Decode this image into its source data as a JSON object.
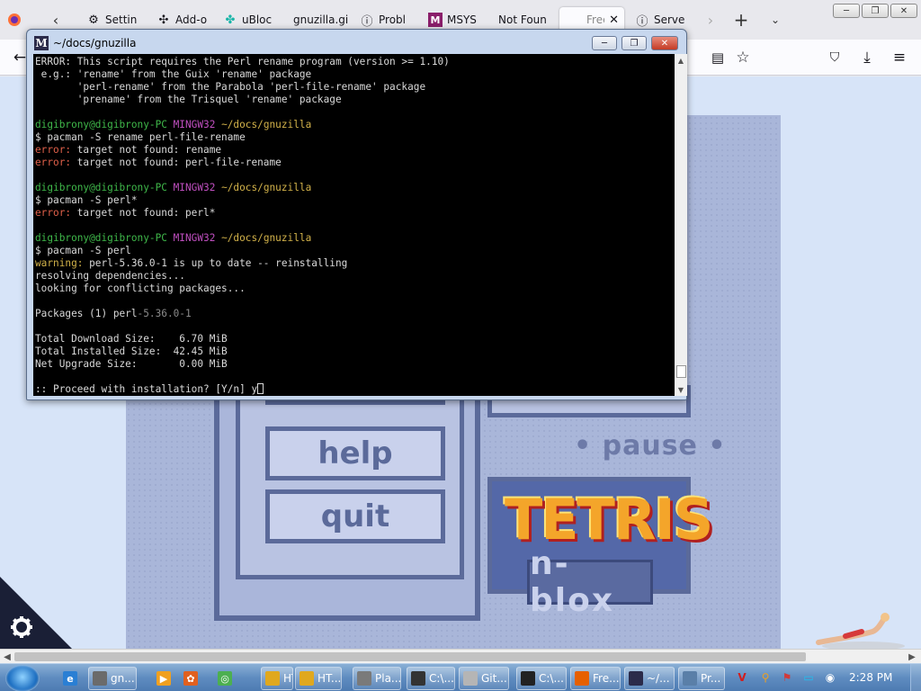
{
  "browser": {
    "tabs": [
      {
        "label": "Settin",
        "icon": "gear-icon"
      },
      {
        "label": "Add-o",
        "icon": "puzzle-icon"
      },
      {
        "label": "uBloc",
        "icon": "ublock-icon"
      },
      {
        "label": "gnuzilla.gi",
        "icon": "page-icon"
      },
      {
        "label": "Probl",
        "icon": "info-icon"
      },
      {
        "label": "MSYS",
        "icon": "msys-icon"
      },
      {
        "label": "Not Foun",
        "icon": "none"
      },
      {
        "label": "Free",
        "icon": "none"
      },
      {
        "label": "Server",
        "icon": "info-icon"
      }
    ]
  },
  "terminal": {
    "title": "~/docs/gnuzilla",
    "logo": "M",
    "lines": [
      [
        {
          "t": "ERROR: This script requires the Perl rename program (version >= 1.10)",
          "c": "#d9d9d9"
        }
      ],
      [
        {
          "t": " e.g.: 'rename' from the Guix 'rename' package",
          "c": "#d9d9d9"
        }
      ],
      [
        {
          "t": "       'perl-rename' from the Parabola 'perl-file-rename' package",
          "c": "#d9d9d9"
        }
      ],
      [
        {
          "t": "       'prename' from the Trisquel 'rename' package",
          "c": "#d9d9d9"
        }
      ],
      [
        {
          "t": "",
          "c": "#d9d9d9"
        }
      ],
      [
        {
          "t": "digibrony@digibrony-PC ",
          "c": "#3fb84a"
        },
        {
          "t": "MINGW32 ",
          "c": "#c04fc0"
        },
        {
          "t": "~/docs/gnuzilla",
          "c": "#d2b24a"
        }
      ],
      [
        {
          "t": "$ pacman -S rename perl-file-rename",
          "c": "#d9d9d9"
        }
      ],
      [
        {
          "t": "error:",
          "c": "#e0604a"
        },
        {
          "t": " target not found: rename",
          "c": "#d9d9d9"
        }
      ],
      [
        {
          "t": "error:",
          "c": "#e0604a"
        },
        {
          "t": " target not found: perl-file-rename",
          "c": "#d9d9d9"
        }
      ],
      [
        {
          "t": "",
          "c": "#d9d9d9"
        }
      ],
      [
        {
          "t": "digibrony@digibrony-PC ",
          "c": "#3fb84a"
        },
        {
          "t": "MINGW32 ",
          "c": "#c04fc0"
        },
        {
          "t": "~/docs/gnuzilla",
          "c": "#d2b24a"
        }
      ],
      [
        {
          "t": "$ pacman -S perl*",
          "c": "#d9d9d9"
        }
      ],
      [
        {
          "t": "error:",
          "c": "#e0604a"
        },
        {
          "t": " target not found: perl*",
          "c": "#d9d9d9"
        }
      ],
      [
        {
          "t": "",
          "c": "#d9d9d9"
        }
      ],
      [
        {
          "t": "digibrony@digibrony-PC ",
          "c": "#3fb84a"
        },
        {
          "t": "MINGW32 ",
          "c": "#c04fc0"
        },
        {
          "t": "~/docs/gnuzilla",
          "c": "#d2b24a"
        }
      ],
      [
        {
          "t": "$ pacman -S perl",
          "c": "#d9d9d9"
        }
      ],
      [
        {
          "t": "warning:",
          "c": "#d2b24a"
        },
        {
          "t": " perl-5.36.0-1 is up to date -- reinstalling",
          "c": "#d9d9d9"
        }
      ],
      [
        {
          "t": "resolving dependencies...",
          "c": "#d9d9d9"
        }
      ],
      [
        {
          "t": "looking for conflicting packages...",
          "c": "#d9d9d9"
        }
      ],
      [
        {
          "t": "",
          "c": "#d9d9d9"
        }
      ],
      [
        {
          "t": "Packages (1) ",
          "c": "#d9d9d9"
        },
        {
          "t": "perl",
          "c": "#d9d9d9"
        },
        {
          "t": "-5.36.0-1",
          "c": "#8a8a8a"
        }
      ],
      [
        {
          "t": "",
          "c": "#d9d9d9"
        }
      ],
      [
        {
          "t": "Total Download Size:    6.70 MiB",
          "c": "#d9d9d9"
        }
      ],
      [
        {
          "t": "Total Installed Size:  42.45 MiB",
          "c": "#d9d9d9"
        }
      ],
      [
        {
          "t": "Net Upgrade Size:       0.00 MiB",
          "c": "#d9d9d9"
        }
      ],
      [
        {
          "t": "",
          "c": "#d9d9d9"
        }
      ],
      [
        {
          "t": ":: Proceed with installation? [Y/n] y",
          "c": "#d9d9d9"
        }
      ]
    ]
  },
  "game": {
    "menu_help": "help",
    "menu_quit": "quit",
    "pause_label": "• pause •",
    "logo_title": "TETRIS",
    "logo_subtitle": "n-blox"
  },
  "taskbar": {
    "items": [
      {
        "label": "gn...",
        "color": "#6b6b6b"
      },
      {
        "label": "HT...",
        "color": "#e0a81e"
      },
      {
        "label": "HT...",
        "color": "#e0a81e"
      },
      {
        "label": "Pla...",
        "color": "#7a7a7a"
      },
      {
        "label": "C:\\...",
        "color": "#333333"
      },
      {
        "label": "Git...",
        "color": "#b5b5b5"
      },
      {
        "label": "C:\\...",
        "color": "#222222"
      },
      {
        "label": "Fre...",
        "color": "#e66000"
      },
      {
        "label": "~/...",
        "color": "#2b2b4a"
      },
      {
        "label": "Pr...",
        "color": "#5a7fa8"
      }
    ],
    "clock": "2:28 PM"
  },
  "colors": {
    "terminal_bg": "#000000",
    "prompt_user": "#3fb84a",
    "prompt_host": "#c04fc0",
    "prompt_path": "#d2b24a",
    "error": "#e0604a",
    "game_frame": "#5b6a9a"
  }
}
